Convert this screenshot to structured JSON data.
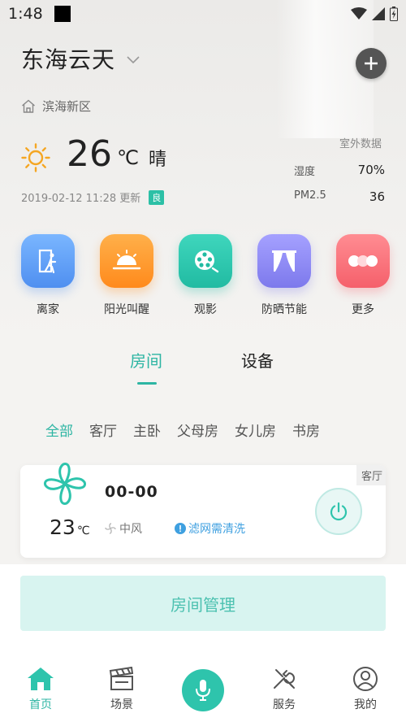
{
  "status_bar": {
    "time": "1:48"
  },
  "header": {
    "home_name": "东海云天",
    "district": "滨海新区"
  },
  "weather": {
    "temperature": "26",
    "unit": "℃",
    "condition": "晴",
    "updated": "2019-02-12 11:28 更新",
    "aqi_badge": "良"
  },
  "outdoor": {
    "title": "室外数据",
    "humidity_label": "湿度",
    "humidity_value": "70%",
    "pm25_label": "PM2.5",
    "pm25_value": "36"
  },
  "scenes": [
    {
      "label": "离家",
      "color": "#5b9cf5",
      "icon": "exit-icon"
    },
    {
      "label": "阳光叫醒",
      "color": "#ff9a2e",
      "icon": "sunrise-icon"
    },
    {
      "label": "观影",
      "color": "#2fcab0",
      "icon": "film-reel-icon"
    },
    {
      "label": "防晒节能",
      "color": "#8c88f2",
      "icon": "curtain-icon"
    },
    {
      "label": "更多",
      "color": "#fb6e78",
      "icon": "more-icon"
    }
  ],
  "main_tabs": {
    "rooms": "房间",
    "devices": "设备"
  },
  "room_filters": [
    "全部",
    "客厅",
    "主卧",
    "父母房",
    "女儿房",
    "书房"
  ],
  "device_card": {
    "room": "客厅",
    "name": "00-00",
    "temperature": "23",
    "unit": "℃",
    "mode": "中风",
    "alert": "滤网需清洗"
  },
  "manage_button": "房间管理",
  "nav": {
    "home": "首页",
    "scene": "场景",
    "service": "服务",
    "mine": "我的"
  },
  "colors": {
    "accent": "#2db5a3",
    "alert": "#3fa0e0"
  }
}
